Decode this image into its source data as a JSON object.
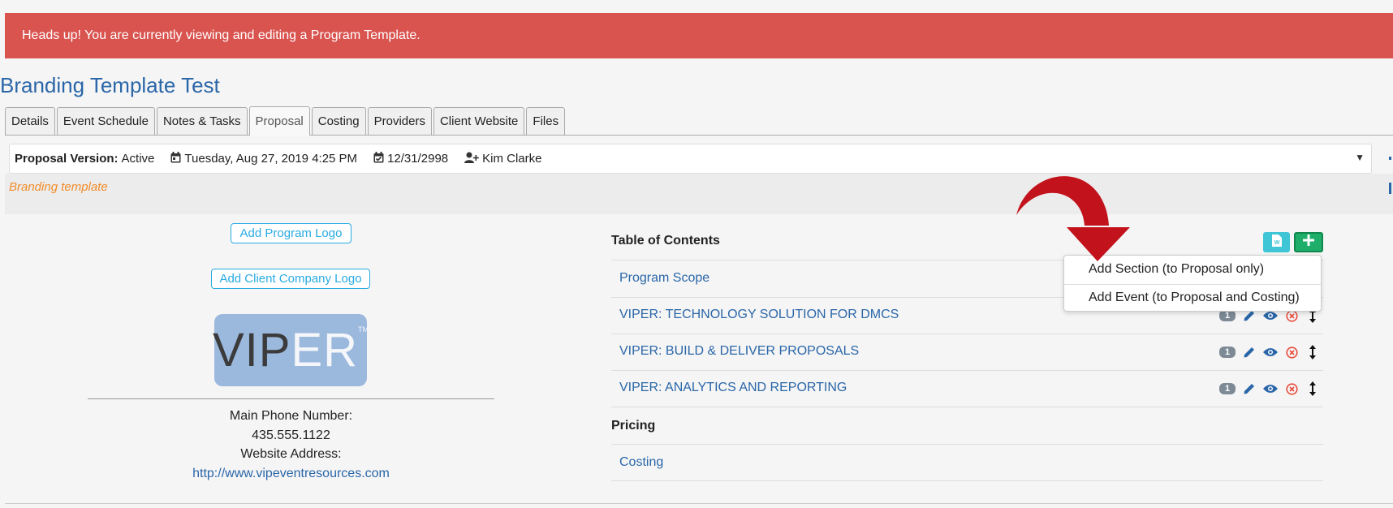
{
  "alert": {
    "text": "Heads up! You are currently viewing and editing a Program Template."
  },
  "page_title": "Branding Template Test",
  "tabs": [
    {
      "label": "Details",
      "active": false
    },
    {
      "label": "Event Schedule",
      "active": false
    },
    {
      "label": "Notes & Tasks",
      "active": false
    },
    {
      "label": "Proposal",
      "active": true
    },
    {
      "label": "Costing",
      "active": false
    },
    {
      "label": "Providers",
      "active": false
    },
    {
      "label": "Client Website",
      "active": false
    },
    {
      "label": "Files",
      "active": false
    }
  ],
  "version_bar": {
    "label": "Proposal Version:",
    "status": "Active",
    "created": "Tuesday, Aug 27, 2019 4:25 PM",
    "due_date": "12/31/2998",
    "owner": "Kim Clarke"
  },
  "branding_note": "Branding template",
  "left_panel": {
    "add_program_logo": "Add Program Logo",
    "add_client_logo": "Add Client Company Logo",
    "logo": {
      "dark": "VIP",
      "light": "ER",
      "tm": "TM"
    },
    "phone_label": "Main Phone Number:",
    "phone": "435.555.1122",
    "website_label": "Website Address:",
    "website": "http://www.vipeventresources.com"
  },
  "toc": {
    "title": "Table of Contents",
    "items": [
      {
        "label": "Program Scope"
      },
      {
        "label": "VIPER: TECHNOLOGY SOLUTION FOR DMCS",
        "count": "1"
      },
      {
        "label": "VIPER: BUILD & DELIVER PROPOSALS",
        "count": "1"
      },
      {
        "label": "VIPER: ANALYTICS AND REPORTING",
        "count": "1"
      }
    ]
  },
  "pricing": {
    "title": "Pricing",
    "items": [
      {
        "label": "Costing"
      }
    ]
  },
  "add_menu": {
    "items": [
      {
        "label": "Add Section (to Proposal only)"
      },
      {
        "label": "Add Event (to Proposal and Costing)"
      }
    ]
  },
  "colors": {
    "alert_bg": "#d9534f",
    "link": "#2a66a8",
    "accent_orange": "#f28c28",
    "outline_blue": "#29abe2",
    "word_button": "#3ec6d6",
    "add_button": "#1fae6a",
    "delete_red": "#e84c3d",
    "arrow_red": "#c2121c"
  },
  "icons": {
    "version_created": "calendar-icon",
    "version_due": "calendar-check-icon",
    "owner": "user-plus-icon",
    "row_actions": [
      "pencil-icon",
      "eye-icon",
      "delete-circle-icon",
      "move-vertical-icon"
    ],
    "toolbar": [
      "word-doc-icon",
      "plus-icon"
    ]
  }
}
